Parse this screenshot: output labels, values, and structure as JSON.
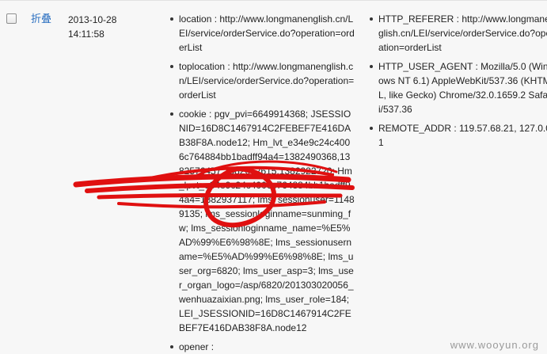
{
  "row": {
    "collapse_label": "折叠",
    "date": "2013-10-28",
    "time": "14:11:58"
  },
  "column_a": [
    {
      "text": "location : http://www.longmanenglish.cn/LEI/service/orderService.do?operation=orderList"
    },
    {
      "text": "toplocation : http://www.longmanenglish.cn/LEI/service/orderService.do?operation=orderList"
    },
    {
      "text": "cookie : pgv_pvi=6649914368; JSESSIONID=16D8C1467914C2FEBEF7E416DAB38F8A.node12; Hm_lvt_e34e9c24c4006c764884bb1badff94a4=1382490368,1382576457,1382662615,1382922720; Hm_lpvt_e34e9c24c4006c764884bb1badff94a4=1382937117; lms_sessionuser=11489135; lms_sessionloginname=sunming_fw; lms_sessionloginname_name=%E5%AD%99%E6%98%8E; lms_sessionusername=%E5%AD%99%E6%98%8E; lms_user_org=6820; lms_user_asp=3; lms_user_organ_logo=/asp/6820/201303020056_wenhuazaixian.png; lms_user_role=184; LEI_JSESSIONID=16D8C1467914C2FEBEF7E416DAB38F8A.node12"
    },
    {
      "text": "opener :"
    }
  ],
  "column_b": [
    {
      "text": "HTTP_REFERER : http://www.longmanenglish.cn/LEI/service/orderService.do?operation=orderList"
    },
    {
      "text": "HTTP_USER_AGENT : Mozilla/5.0 (Windows NT 6.1) AppleWebKit/537.36 (KHTML, like Gecko) Chrome/32.0.1659.2 Safari/537.36"
    },
    {
      "text": "REMOTE_ADDR : 119.57.68.21, 127.0.0.1"
    }
  ],
  "watermark": "www.wooyun.org",
  "colors": {
    "link": "#2a6fc0",
    "redaction": "#e01010",
    "background": "#f7f7f7"
  }
}
